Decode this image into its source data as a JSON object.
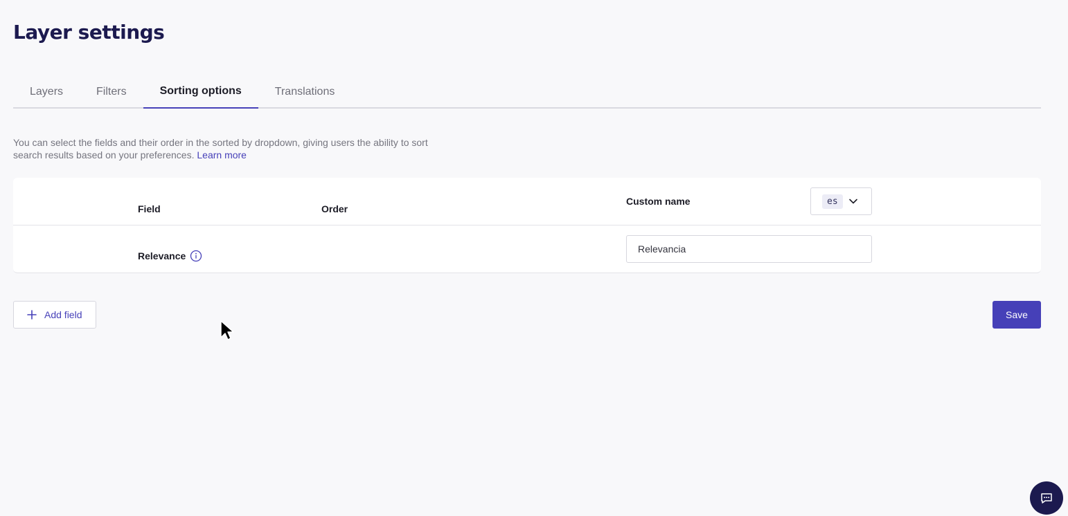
{
  "page": {
    "title": "Layer settings"
  },
  "tabs": [
    {
      "label": "Layers",
      "active": false
    },
    {
      "label": "Filters",
      "active": false
    },
    {
      "label": "Sorting options",
      "active": true
    },
    {
      "label": "Translations",
      "active": false
    }
  ],
  "description": {
    "text": "You can select the fields and their order in the sorted by dropdown, giving users the ability to sort search results based on your preferences.",
    "link": "Learn more"
  },
  "table": {
    "headers": {
      "field": "Field",
      "order": "Order",
      "custom_name": "Custom name"
    },
    "language": "es",
    "rows": [
      {
        "field": "Relevance",
        "order": "",
        "custom_name": "Relevancia"
      }
    ]
  },
  "actions": {
    "add_field": "Add field",
    "save": "Save"
  },
  "colors": {
    "accent": "#4640b8",
    "title": "#1c1a4f",
    "background": "#f8f8fa"
  },
  "icons": {
    "language_dropdown": "chevron-down-icon",
    "relevance_info": "info-icon",
    "add_field": "plus-icon",
    "chat": "chat-icon"
  }
}
